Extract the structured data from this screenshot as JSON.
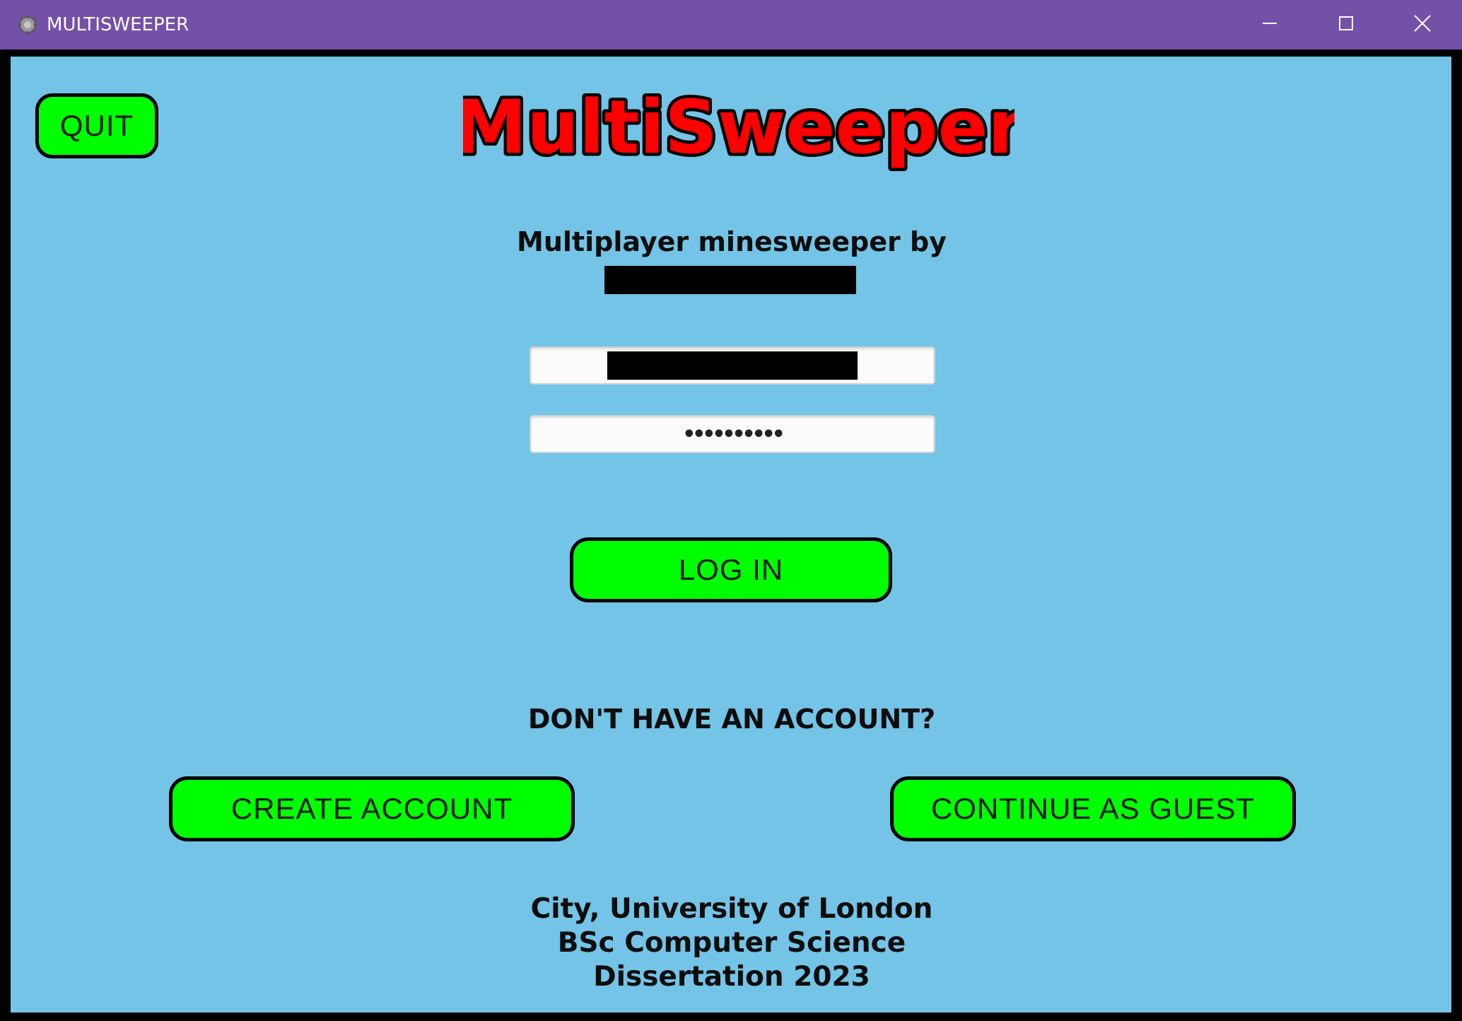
{
  "window": {
    "title": "MULTISWEEPER",
    "icon": "gear-icon",
    "controls": {
      "minimize_icon": "minimize-icon",
      "maximize_icon": "maximize-icon",
      "close_icon": "close-icon"
    },
    "titlebar_color": "#7550a8"
  },
  "app": {
    "logo_text": "MultiSweeper",
    "logo_color": "#ff0000",
    "subtitle": "Multiplayer minesweeper by",
    "background_color": "#73c4e6",
    "button_color": "#00ff00"
  },
  "login": {
    "quit_label": "QUIT",
    "password_mask": "••••••••••",
    "login_label": "LOG IN"
  },
  "signup": {
    "prompt": "DON'T HAVE AN ACCOUNT?",
    "create_label": "CREATE ACCOUNT",
    "guest_label": "CONTINUE AS GUEST"
  },
  "footer": {
    "line1": "City, University of London",
    "line2": "BSc Computer Science",
    "line3": "Dissertation 2023"
  }
}
